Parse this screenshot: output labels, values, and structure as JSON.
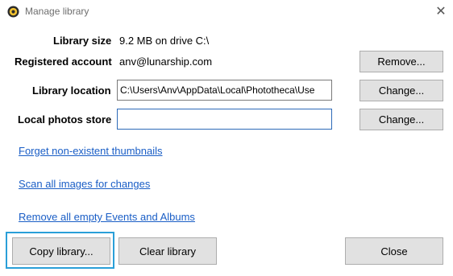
{
  "window": {
    "title": "Manage library",
    "close_glyph": "✕"
  },
  "icons": {
    "app": "app-logo-icon",
    "close": "close-icon"
  },
  "library_size": {
    "label": "Library size",
    "value": "9.2 MB on drive C:\\"
  },
  "registered_account": {
    "label": "Registered account",
    "value": "anv@lunarship.com",
    "button": "Remove..."
  },
  "library_location": {
    "label": "Library location",
    "value": "C:\\Users\\Anv\\AppData\\Local\\Phototheca\\Use",
    "button": "Change..."
  },
  "local_photos_store": {
    "label": "Local photos store",
    "value": "",
    "button": "Change..."
  },
  "links": {
    "forget": "Forget non-existent thumbnails",
    "scan": "Scan all images for changes",
    "remove_empty": "Remove all empty Events and Albums"
  },
  "footer": {
    "copy": "Copy library...",
    "clear": "Clear library",
    "close": "Close"
  },
  "colors": {
    "link": "#1a5ec6",
    "focus": "#2a9fd8",
    "button_bg": "#e1e1e1"
  }
}
